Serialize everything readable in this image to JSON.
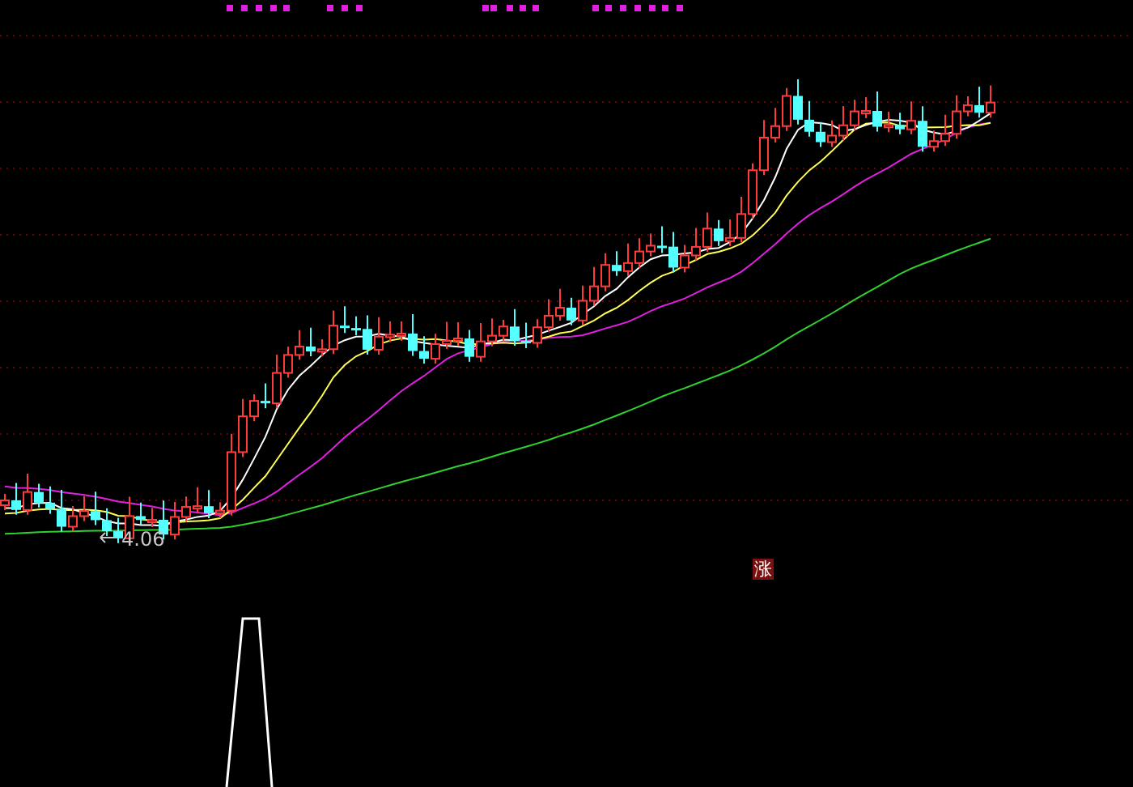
{
  "price_chart": {
    "low_label": "4.06"
  },
  "signal_panel": {
    "signal_label": "涨"
  }
}
